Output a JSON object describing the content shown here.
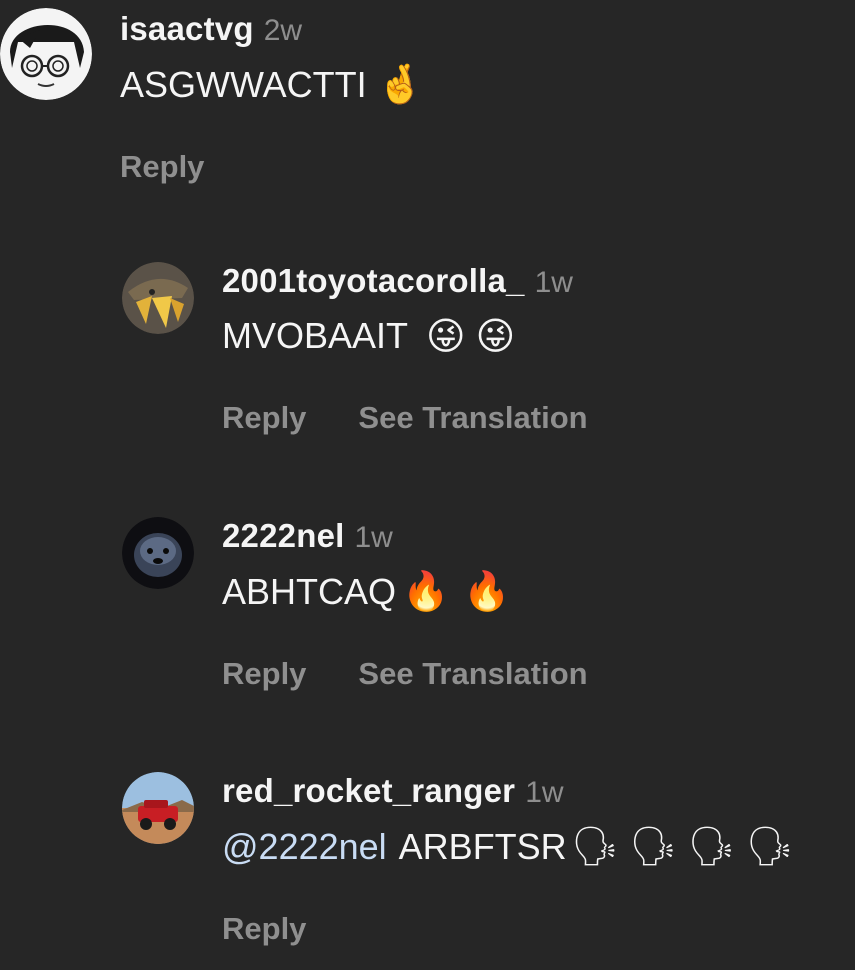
{
  "comments": [
    {
      "username": "isaactvg",
      "time": "2w",
      "text": "ASGWWACTTI",
      "emojis": [
        "🤞"
      ],
      "actions": [
        "Reply"
      ]
    },
    {
      "username": "2001toyotacorolla_",
      "time": "1w",
      "text": "MVOBAAIT",
      "emojis": [
        "😜",
        "😜"
      ],
      "actions": [
        "Reply",
        "See Translation"
      ]
    },
    {
      "username": "2222nel",
      "time": "1w",
      "text": "ABHTCAQ",
      "emojis": [
        "🔥",
        "🔥"
      ],
      "actions": [
        "Reply",
        "See Translation"
      ]
    },
    {
      "username": "red_rocket_ranger",
      "time": "1w",
      "mention": "@2222nel",
      "text": "ARBFTSR",
      "emojis": [
        "🗣",
        "🗣",
        "🗣",
        "🗣"
      ],
      "actions": [
        "Reply"
      ]
    }
  ],
  "colors": {
    "background": "#262626",
    "username": "#f5f5f5",
    "muted": "#8f8f8f",
    "mention": "#c9dcf4"
  }
}
